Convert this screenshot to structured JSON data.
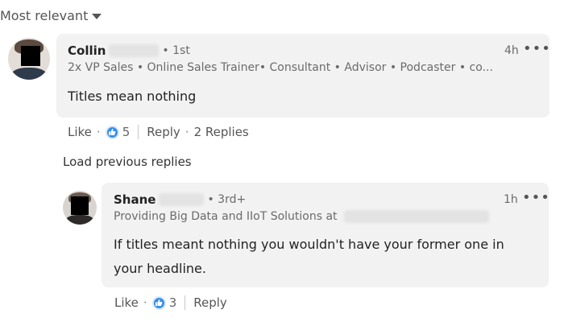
{
  "sort": {
    "label": "Most relevant",
    "icon": "caret-down-icon"
  },
  "comment": {
    "author_name": "Collin",
    "degree": "• 1st",
    "headline": "2x VP Sales • Online Sales Trainer• Consultant • Advisor • Podcaster • co...",
    "time": "4h",
    "more_label": "•••",
    "text": "Titles mean nothing",
    "like_label": "Like",
    "dot": "·",
    "reaction_count": "5",
    "reply_label": "Reply",
    "replies_label": "2 Replies"
  },
  "load_previous": "Load previous replies",
  "reply": {
    "author_name": "Shane",
    "degree": "• 3rd+",
    "headline": "Providing Big Data and IIoT Solutions at",
    "time": "1h",
    "more_label": "•••",
    "text_line1": "If titles meant nothing you wouldn't have your former one in",
    "text_line2": "your headline.",
    "like_label": "Like",
    "dot": "·",
    "reaction_count": "3",
    "reply_label": "Reply"
  },
  "colors": {
    "reaction_blue": "#378fe9",
    "bubble_bg": "#f2f2f2"
  }
}
